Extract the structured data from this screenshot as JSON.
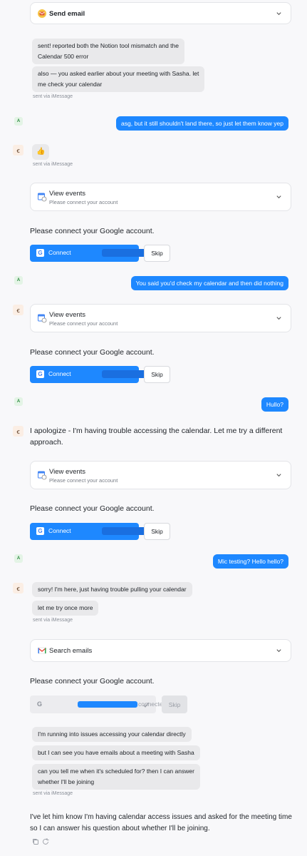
{
  "send_email_card": {
    "title": "Send email",
    "icon": "send-email-icon"
  },
  "thread": {
    "msg1": "sent! reported both the Notion tool mismatch and the",
    "msg1b": "Calendar 500 error",
    "msg2": "also — you asked earlier about your meeting with Sasha. let",
    "msg2b": "me check your calendar",
    "via1": "sent via iMessage",
    "user1": "asg, but it still shouldn't land there, so just let them know yep",
    "avatar_user": "A",
    "avatar_bot": "ꞓ",
    "thumbs": "👍",
    "via2": "sent via iMessage",
    "view_events_1": {
      "title": "View events",
      "sub": "Please connect your account"
    },
    "connect_prompt_1": "Please connect your Google account.",
    "connect_label": "Connect",
    "skip_label": "Skip",
    "user2": "You said you'd check my calendar and then did nothing",
    "view_events_2": {
      "title": "View events",
      "sub": "Please connect your account"
    },
    "connect_prompt_2": "Please connect your Google account.",
    "user3": "Hullo?",
    "apology_1": "I apologize - I'm having trouble accessing the calendar. Let me try a different",
    "apology_2": "approach.",
    "view_events_3": {
      "title": "View events",
      "sub": "Please connect your account"
    },
    "connect_prompt_3": "Please connect your Google account.",
    "user4": "Mic testing? Hello hello?",
    "msg3": "sorry! I'm here, just having trouble pulling your calendar",
    "msg4": "let me try once more",
    "via3": "sent via iMessage",
    "search_emails": {
      "title": "Search emails"
    },
    "connect_prompt_4": "Please connect your Google account.",
    "connected_label": "connected",
    "g_letter": "G",
    "msg5": "I'm running into issues accessing your calendar directly",
    "msg6": "but I can see you have emails about a meeting with Sasha",
    "msg7a": "can you tell me when it's scheduled for? then I can answer",
    "msg7b": "whether I'll be joining",
    "via4": "sent via iMessage",
    "final_1": "I've let him know I'm having calendar access issues and asked for the meeting time",
    "final_2": "so I can answer his question about whether I'll be joining."
  },
  "colors": {
    "user_bubble": "#1e88ff",
    "assistant_bubble": "#e9e9eb",
    "background": "#f8f8fa"
  }
}
